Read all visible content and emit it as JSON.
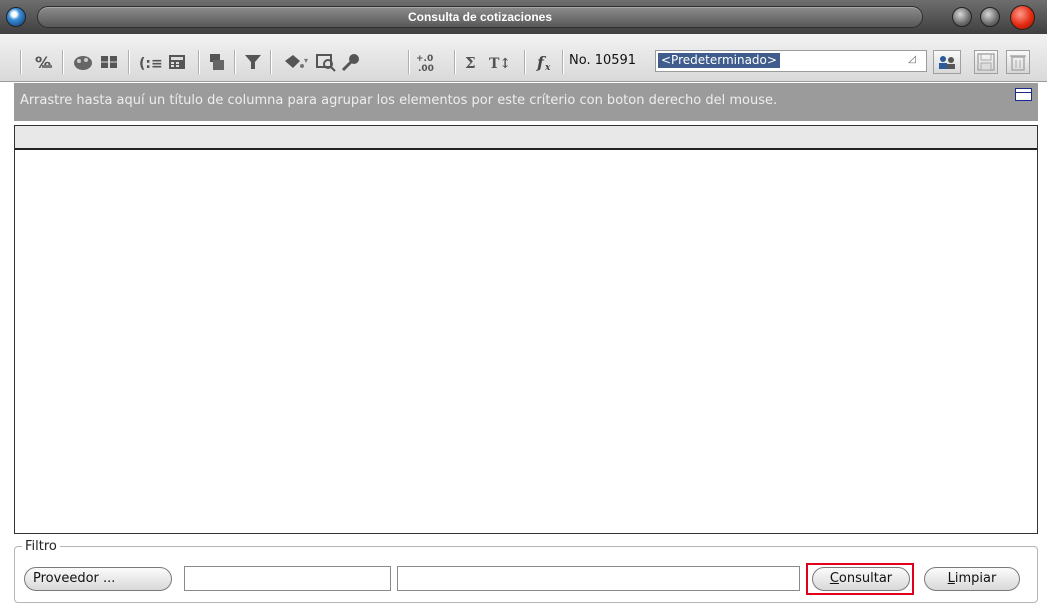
{
  "window": {
    "title": "Consulta de cotizaciones"
  },
  "toolbar": {
    "icons": [
      "percent-edit-icon",
      "palette-icon",
      "columns-icon",
      "indent-list-icon",
      "calculator-icon",
      "stack-icon",
      "filter-icon",
      "paint-bucket-icon",
      "search-image-icon",
      "key-icon",
      "decimal-icon",
      "sum-icon",
      "text-size-icon",
      "function-icon"
    ],
    "number_label": "No. 10591",
    "layout_select": {
      "value": "<Predeterminado>"
    }
  },
  "group_panel": {
    "hint": "Arrastre hasta aquí un título de columna para agrupar los elementos por este críterio con boton derecho del mouse."
  },
  "filter": {
    "legend": "Filtro",
    "proveedor_label": "Proveedor ...",
    "consultar_label": "Consultar",
    "limpiar_label": "Limpiar"
  },
  "colors": {
    "titlebar": "#4a4a4a",
    "group_panel": "#9b9b9b",
    "highlight": "#e0001b",
    "selection": "#3f5c8c"
  }
}
